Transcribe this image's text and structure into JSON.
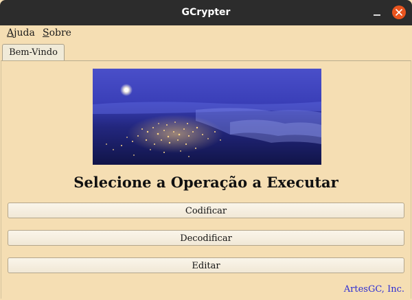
{
  "window": {
    "title": "GCrypter"
  },
  "menu": {
    "ajuda_first": "A",
    "ajuda_rest": "juda",
    "sobre_first": "S",
    "sobre_rest": "obre"
  },
  "tabs": [
    {
      "label": "Bem-Vindo"
    }
  ],
  "main": {
    "heading": "Selecione a Operação a Executar",
    "buttons": [
      "Codificar",
      "Decodificar",
      "Editar"
    ],
    "footer": "ArtesGC, Inc."
  },
  "colors": {
    "background": "#f5deb3",
    "titlebar": "#2c2c2c",
    "close": "#e9541e",
    "footer_link": "#2c2cd4"
  }
}
